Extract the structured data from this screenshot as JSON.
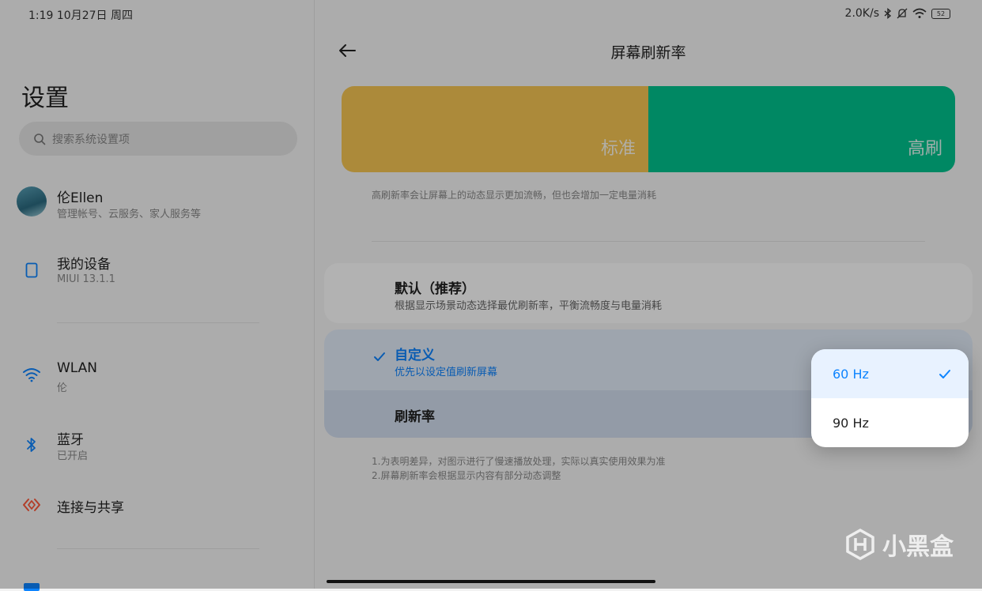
{
  "status_bar": {
    "left": "1:19  10月27日 周四",
    "right": "2.0K/s",
    "battery": "52"
  },
  "sidebar": {
    "title": "设置",
    "search_placeholder": "搜索系统设置项",
    "account": {
      "name": "伦Ellen",
      "subtitle": "管理帐号、云服务、家人服务等"
    },
    "device": {
      "title": "我的设备",
      "subtitle": "MIUI 13.1.1"
    },
    "wlan": {
      "title": "WLAN",
      "subtitle": "伦"
    },
    "bluetooth": {
      "title": "蓝牙",
      "subtitle": "已开启"
    },
    "share": {
      "title": "连接与共享"
    }
  },
  "main": {
    "title": "屏幕刷新率",
    "preview": {
      "standard_label": "标准",
      "high_label": "高刷"
    },
    "description": "高刷新率会让屏幕上的动态显示更加流畅，但也会增加一定电量消耗",
    "option_default": {
      "title": "默认（推荐）",
      "subtitle": "根据显示场景动态选择最优刷新率，平衡流畅度与电量消耗"
    },
    "option_custom": {
      "title": "自定义",
      "subtitle": "优先以设定值刷新屏幕"
    },
    "refresh_rate_label": "刷新率",
    "notes": [
      "1.为表明差异，对图示进行了慢速播放处理，实际以真实使用效果为准",
      "2.屏幕刷新率会根据显示内容有部分动态调整"
    ]
  },
  "popup": {
    "options": [
      "60 Hz",
      "90 Hz"
    ],
    "selected": "60 Hz"
  },
  "watermark": "小黑盒",
  "colors": {
    "accent": "#0d84ff",
    "standard": "#f6c653",
    "high": "#00c38e"
  }
}
